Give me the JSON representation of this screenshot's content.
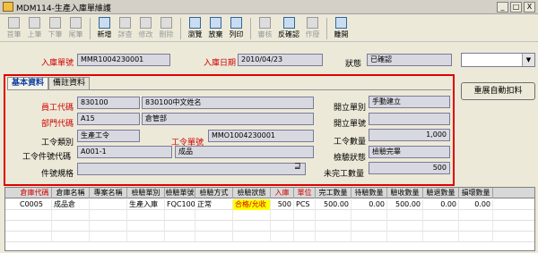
{
  "window": {
    "title": "MDM114-生產入庫單維護",
    "buttons": [
      "_",
      "□",
      "X"
    ]
  },
  "toolbar": [
    {
      "label": "首筆",
      "icon": "first-icon",
      "enabled": false
    },
    {
      "label": "上筆",
      "icon": "prev-icon",
      "enabled": false
    },
    {
      "label": "下筆",
      "icon": "next-icon",
      "enabled": false
    },
    {
      "label": "尾筆",
      "icon": "last-icon",
      "enabled": false
    },
    {
      "label": "新增",
      "icon": "new-doc-icon",
      "enabled": true
    },
    {
      "label": "詳查",
      "icon": "detail-icon",
      "enabled": false
    },
    {
      "label": "修改",
      "icon": "edit-icon",
      "enabled": false
    },
    {
      "label": "刪除",
      "icon": "delete-icon",
      "enabled": false
    },
    {
      "label": "瀏覽",
      "icon": "browse-icon",
      "enabled": true
    },
    {
      "label": "放棄",
      "icon": "discard-icon",
      "enabled": true
    },
    {
      "label": "列印",
      "icon": "print-icon",
      "enabled": true
    },
    {
      "label": "審核",
      "icon": "approve-icon",
      "enabled": false
    },
    {
      "label": "反確認",
      "icon": "unconfirm-icon",
      "enabled": true
    },
    {
      "label": "作廢",
      "icon": "void-icon",
      "enabled": false
    },
    {
      "label": "離開",
      "icon": "exit-icon",
      "enabled": true
    }
  ],
  "header": {
    "doc_no_label": "入庫單號",
    "doc_no": "MMR1004230001",
    "date_label": "入庫日期",
    "date": "2010/04/23",
    "status_label": "狀態",
    "status": "已確認",
    "dropdown_value": ""
  },
  "tabs": [
    "基本資料",
    "備註資料"
  ],
  "form": {
    "emp_label": "員工代碼",
    "emp_code": "830100",
    "emp_name": "830100中文姓名",
    "dept_label": "部門代碼",
    "dept_code": "A15",
    "dept_name": "倉管部",
    "wo_type_label": "工令類別",
    "wo_type": "生產工令",
    "wo_no_label": "工令單號",
    "wo_no": "MMO1004230001",
    "wo_part_label": "工令件號代碼",
    "wo_part": "A001-1",
    "wo_part_name": "成品",
    "spec_label": "件號規格",
    "spec": "",
    "open_label": "開立單別",
    "open_value": "手動建立",
    "open_no_label": "開立單號",
    "open_no": "",
    "wo_qty_label": "工令數量",
    "wo_qty": "1,000",
    "check_label": "檢驗狀態",
    "check_status": "檢驗完畢",
    "unfinished_label": "未完工數量",
    "unfinished_qty": "500"
  },
  "action_button": "重展自動扣料",
  "grid": {
    "columns": [
      {
        "label": "倉庫代碼",
        "red": true
      },
      {
        "label": "倉庫名稱",
        "red": false
      },
      {
        "label": "專案名稱",
        "red": false
      },
      {
        "label": "檢驗單別",
        "red": false
      },
      {
        "label": "檢驗單號",
        "red": false
      },
      {
        "label": "檢驗方式",
        "red": false
      },
      {
        "label": "檢驗狀態",
        "red": false
      },
      {
        "label": "入庫",
        "red": true
      },
      {
        "label": "單位",
        "red": true
      },
      {
        "label": "完工數量",
        "red": false
      },
      {
        "label": "待驗數量",
        "red": false
      },
      {
        "label": "驗收數量",
        "red": false
      },
      {
        "label": "驗退數量",
        "red": false
      },
      {
        "label": "損壞數量",
        "red": false
      }
    ],
    "rows": [
      [
        "C0005",
        "成品倉",
        "",
        "生產入庫",
        "FQC100",
        "正常",
        "合格/允收",
        "500",
        "PCS",
        "500.00",
        "0.00",
        "500.00",
        "0.00",
        "0.00"
      ]
    ]
  },
  "colors": {
    "accent_red": "#e00000",
    "highlight": "#ffff00"
  }
}
